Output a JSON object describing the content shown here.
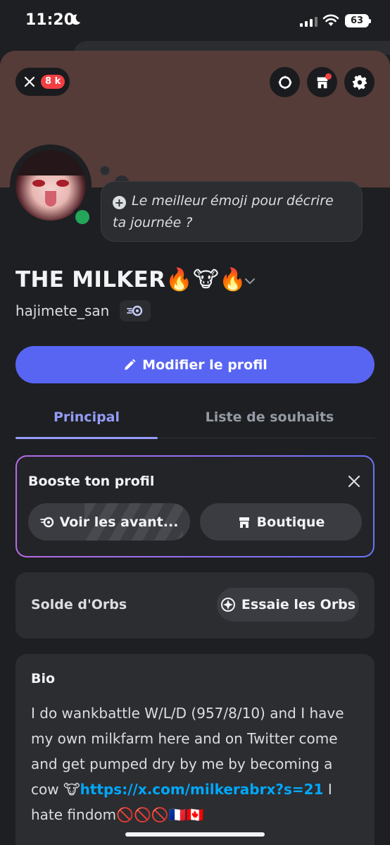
{
  "status_bar": {
    "time": "11:20",
    "battery": "63"
  },
  "header": {
    "notification_count": "8 k"
  },
  "profile": {
    "status_prompt": "Le meilleur émoji pour décrire ta journée ?",
    "display_name": "THE MILKER🔥🐮🔥",
    "username": "hajimete_san"
  },
  "actions": {
    "edit_profile": "Modifier le profil"
  },
  "tabs": [
    {
      "label": "Principal"
    },
    {
      "label": "Liste de souhaits"
    }
  ],
  "boost": {
    "title": "Booste ton profil",
    "perks_label": "Voir les avant...",
    "shop_label": "Boutique"
  },
  "orbs": {
    "label": "Solde d'Orbs",
    "button_label": "Essaie les Orbs"
  },
  "bio": {
    "label": "Bio",
    "text_before": "I do wankbattle W/L/D (957/8/10) and  I have my own milkfarm here and on Twitter come and get pumped dry by me by becoming a cow 🐮",
    "link": "https://x.com/milkerabrx?s=21",
    "text_after": " I hate findom🚫🚫🚫🇫🇷🇨🇦"
  },
  "colors": {
    "banner": "#553c38",
    "accent": "#5865f2",
    "tab_active": "#949cf7",
    "online": "#23a55a",
    "badge": "#f23f43",
    "link": "#00a8fc"
  }
}
